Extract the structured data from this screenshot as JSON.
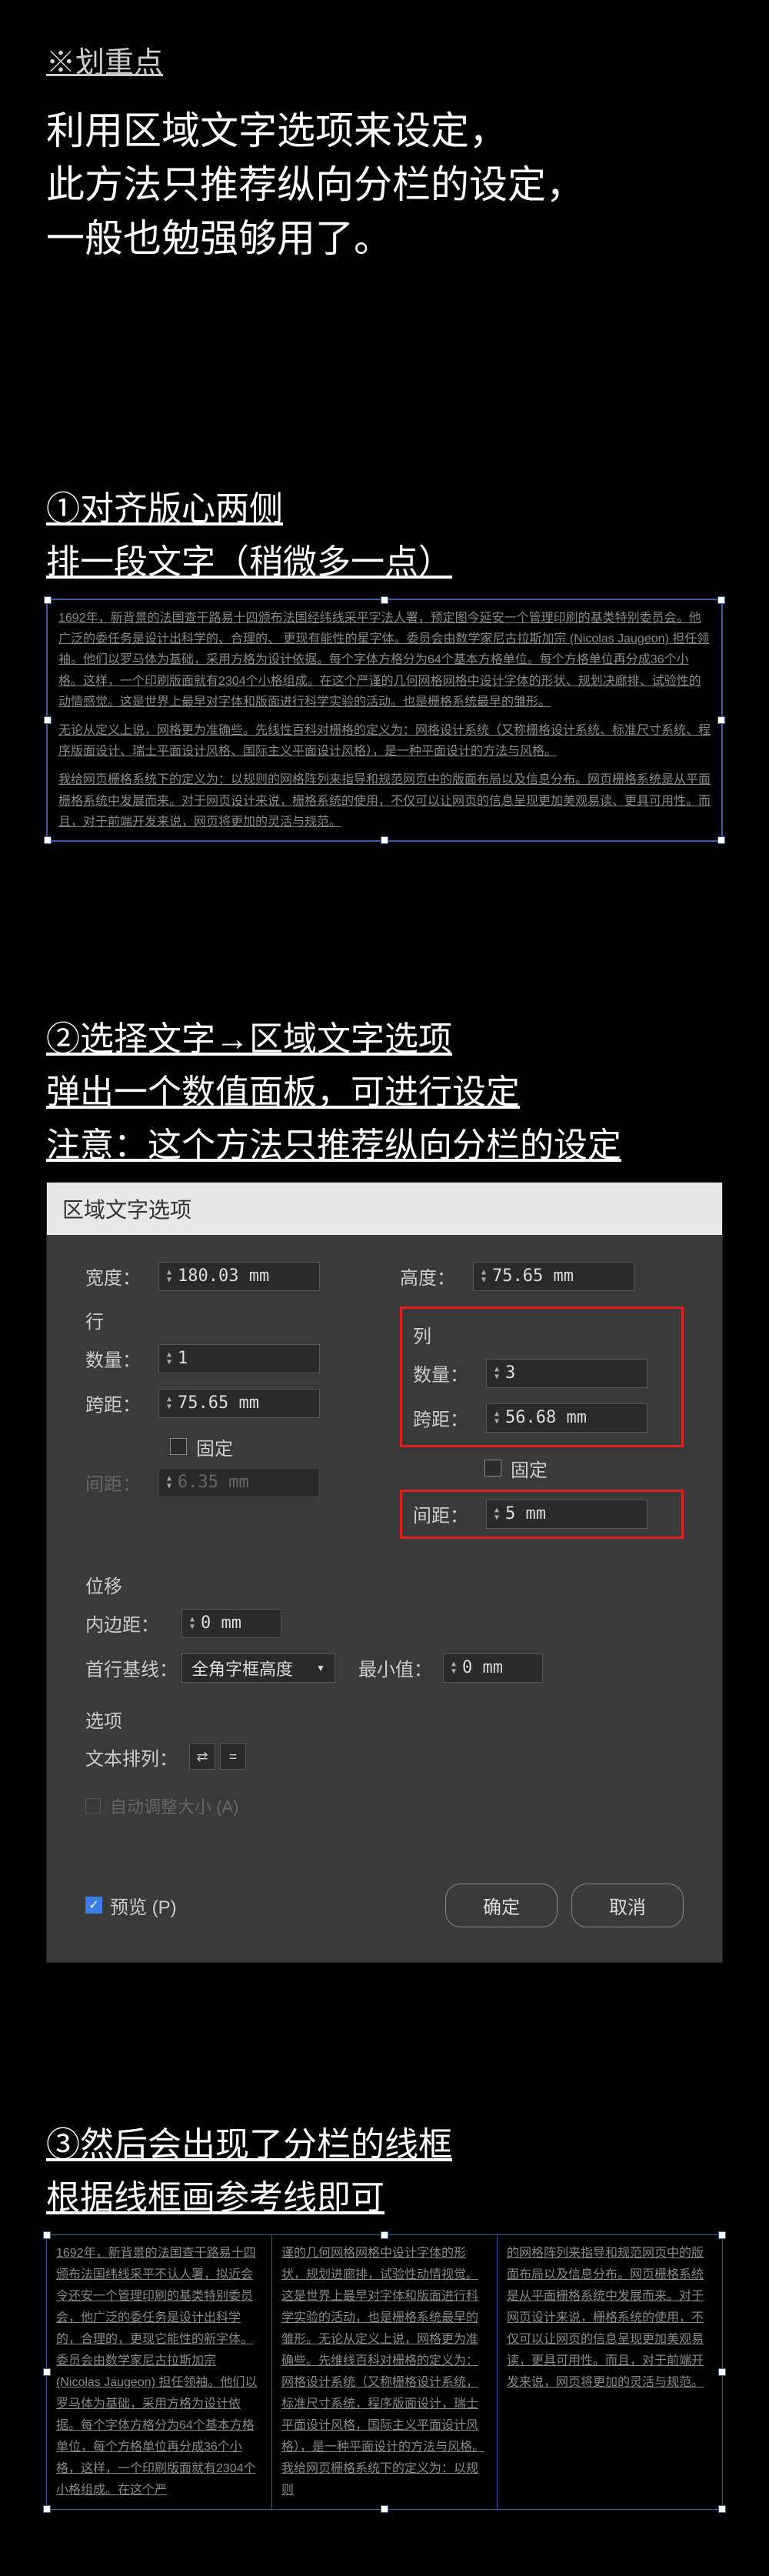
{
  "highlight_label": "※划重点",
  "intro": "利用区域文字选项来设定，\n此方法只推荐纵向分栏的设定，\n一般也勉强够用了。",
  "step1": {
    "title": "①对齐版心两侧",
    "subtitle": "排一段文字（稍微多一点）",
    "body_p1": "1692年，新背景的法国查干路易十四颁布法国经纬线采平字法人署，预定图今延安一个管理印刷的基类特别委员会。他广泛的委任务是设计出科学的、合理的、 更现有能性的星字体。委员会由数学家尼古拉斯加宗 (Nicolas Jaugeon) 担任领袖。他们以罗马体为基础，采用方格为设计依据。每个字体方格分为64个基本方格单位。每个方格单位再分成36个小格。这样，一个印刷版面就有2304个小格组成。在这个严谨的几何网格网格中设计字体的形状、规划决廊排、试验性的动情感觉。这是世界上最早对字体和版面进行科学实验的活动。也是栅格系统最早的雏形。",
    "body_p2": "无论从定义上说，网格更为准确些。先线性百科对栅格的定义为：网格设计系统（又称栅格设计系统、标准尺寸系统、程序版面设计、瑞士平面设计风格、国际主义平面设计风格），是一种平面设计的方法与风格。",
    "body_p3": "我给网页栅格系统下的定义为：以规则的网格阵列来指导和规范网页中的版面布局以及信息分布。网页栅格系统是从平面栅格系统中发展而来。对于网页设计来说，栅格系统的使用，不仅可以让网页的信息呈现更加美观易读、更具可用性。而且，对于前端开发来说，网页将更加的灵活与规范。"
  },
  "step2": {
    "title": "②选择文字→区域文字选项",
    "subtitle1": "弹出一个数值面板，可进行设定",
    "subtitle2": "注意：这个方法只推荐纵向分栏的设定"
  },
  "dialog": {
    "title": "区域文字选项",
    "width_label": "宽度：",
    "width_value": "180.03 mm",
    "height_label": "高度：",
    "height_value": "75.65 mm",
    "row_section": "行",
    "col_section": "列",
    "qty_label": "数量：",
    "row_qty": "1",
    "col_qty": "3",
    "span_label": "跨距：",
    "row_span": "75.65 mm",
    "col_span": "56.68 mm",
    "fixed_label": "固定",
    "gutter_label": "间距：",
    "row_gutter": "6.35 mm",
    "col_gutter": "5 mm",
    "offset_section": "位移",
    "inset_label": "内边距：",
    "inset_value": "0 mm",
    "baseline_label": "首行基线：",
    "baseline_value": "全角字框高度",
    "min_label": "最小值：",
    "min_value": "0 mm",
    "options_section": "选项",
    "textflow_label": "文本排列：",
    "auto_resize": "自动调整大小 (A)",
    "preview": "预览 (P)",
    "ok": "确定",
    "cancel": "取消"
  },
  "step3": {
    "title": "③然后会出现了分栏的线框",
    "subtitle": "根据线框画参考线即可",
    "col1": "1692年，新背景的法国查干路易十四颁布法国纬线采平不认人署，拟近会令还安一个管理印刷的基类特别委员会，他广泛的委任务是设计出科学的，合理的，更现它能性的新字体。委员会由数学家尼古拉斯加宗 (Nicolas Jaugeon) 担任领袖。他们以罗马体为基础，采用方格为设计依据。每个字体方格分为64个基本方格单位，每个方格单位再分成36个小格，这样，一个印刷版面就有2304个小格组成。在这个严",
    "col2": "谨的几何网格网格中设计字体的形状，规划进廊排，试验性动情视觉。这是世界上最早对字体和版面进行科学实验的活动，也是栅格系统最早的雏形。无论从定义上说，网格更为准确些。先维线百科对栅格的定义为：网格设计系统（又称栅格设计系统，标准尺寸系统，程序版面设计，瑞士平面设计风格，国际主义平面设计风格），是一种平面设计的方法与风格。我给网页栅格系统下的定义为：以规则",
    "col3": "的网格阵列来指导和规范网页中的版面布局以及信息分布。网页栅格系统是从平面栅格系统中发展而来。对于网页设计来说，栅格系统的使用，不仅可以让网页的信息呈现更加美观易读，更具可用性。而且，对于前端开发来说，网页将更加的灵活与规范。"
  }
}
